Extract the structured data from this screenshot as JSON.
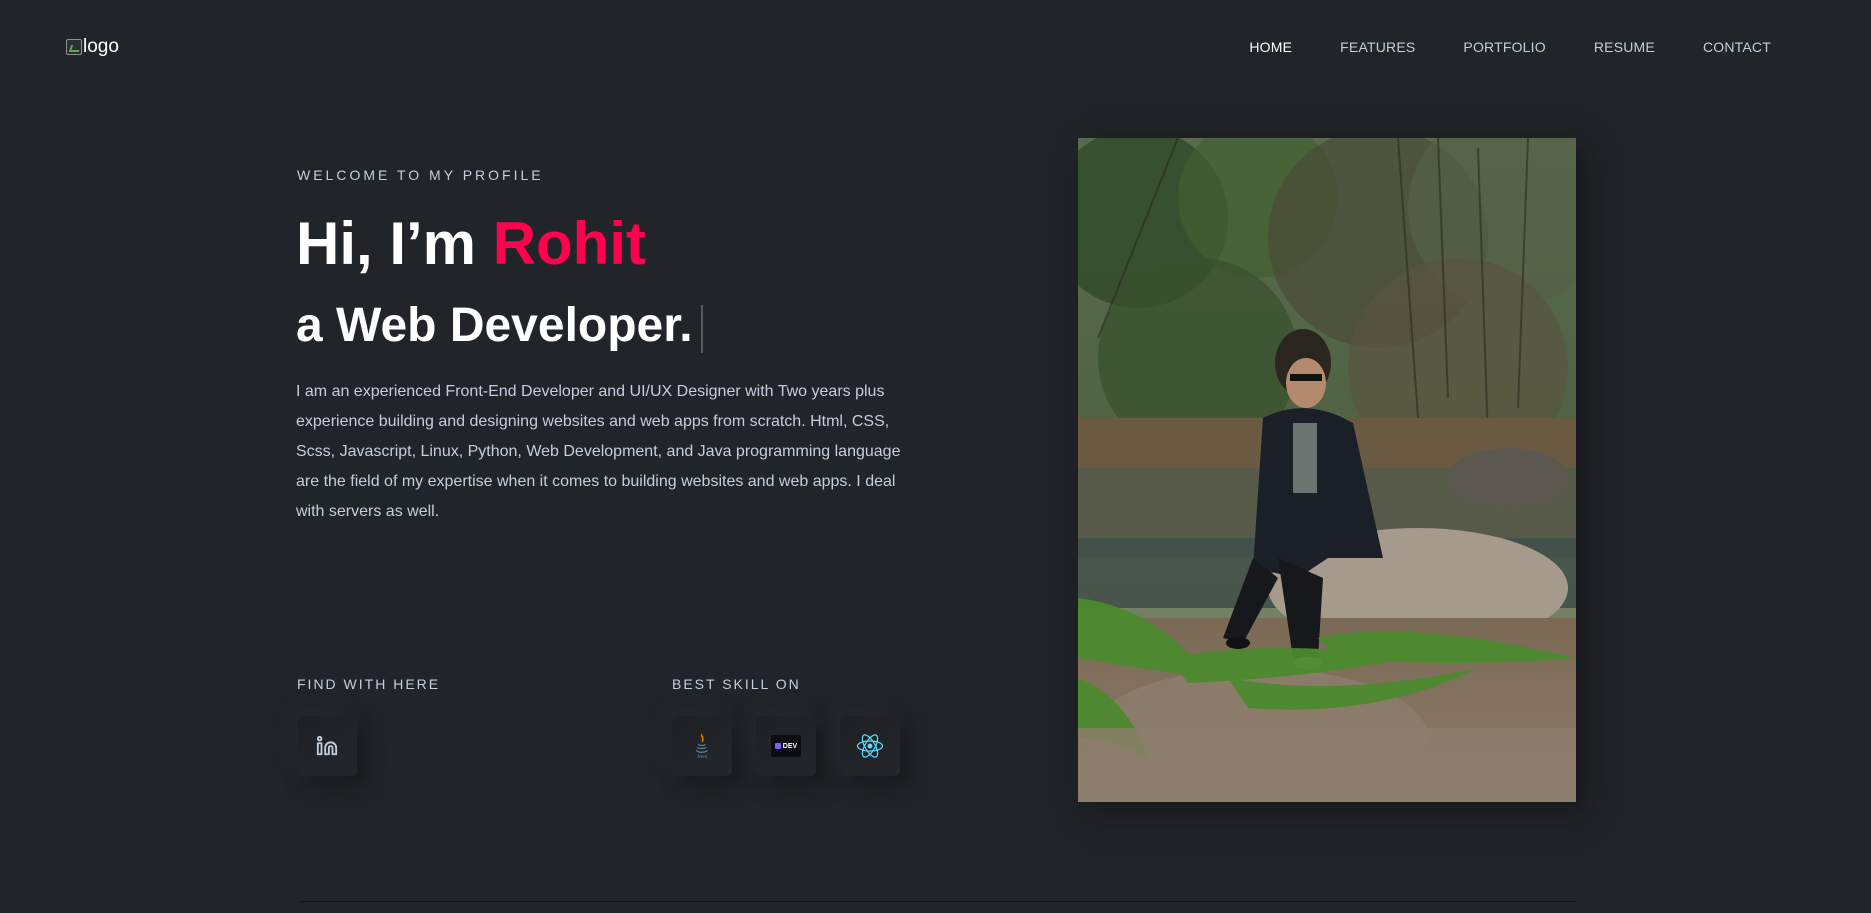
{
  "header": {
    "logo_alt": "logo",
    "nav": [
      {
        "label": "HOME"
      },
      {
        "label": "FEATURES"
      },
      {
        "label": "PORTFOLIO"
      },
      {
        "label": "RESUME"
      },
      {
        "label": "CONTACT"
      }
    ]
  },
  "hero": {
    "kicker": "WELCOME TO MY PROFILE",
    "greeting": "Hi, I’m ",
    "name": "Rohit",
    "subtitle": "a Web Developer.",
    "bio": "I am an experienced Front-End Developer and UI/UX Designer with Two years plus experience building and designing websites and web apps from scratch. Html, CSS, Scss, Javascript, Linux, Python, Web Development, and Java programming language are the field of my expertise when it comes to building websites and web apps. I deal with servers as well."
  },
  "find": {
    "title": "FIND WITH HERE",
    "icons": [
      "linkedin-icon"
    ]
  },
  "skills": {
    "title": "BEST SKILL ON",
    "icons": [
      "java-icon",
      "dev-icon",
      "react-icon"
    ],
    "dev_label": "DEV"
  },
  "colors": {
    "background": "#212428",
    "accent": "#ff014f",
    "text": "#c4cfde",
    "heading": "#ffffff"
  }
}
